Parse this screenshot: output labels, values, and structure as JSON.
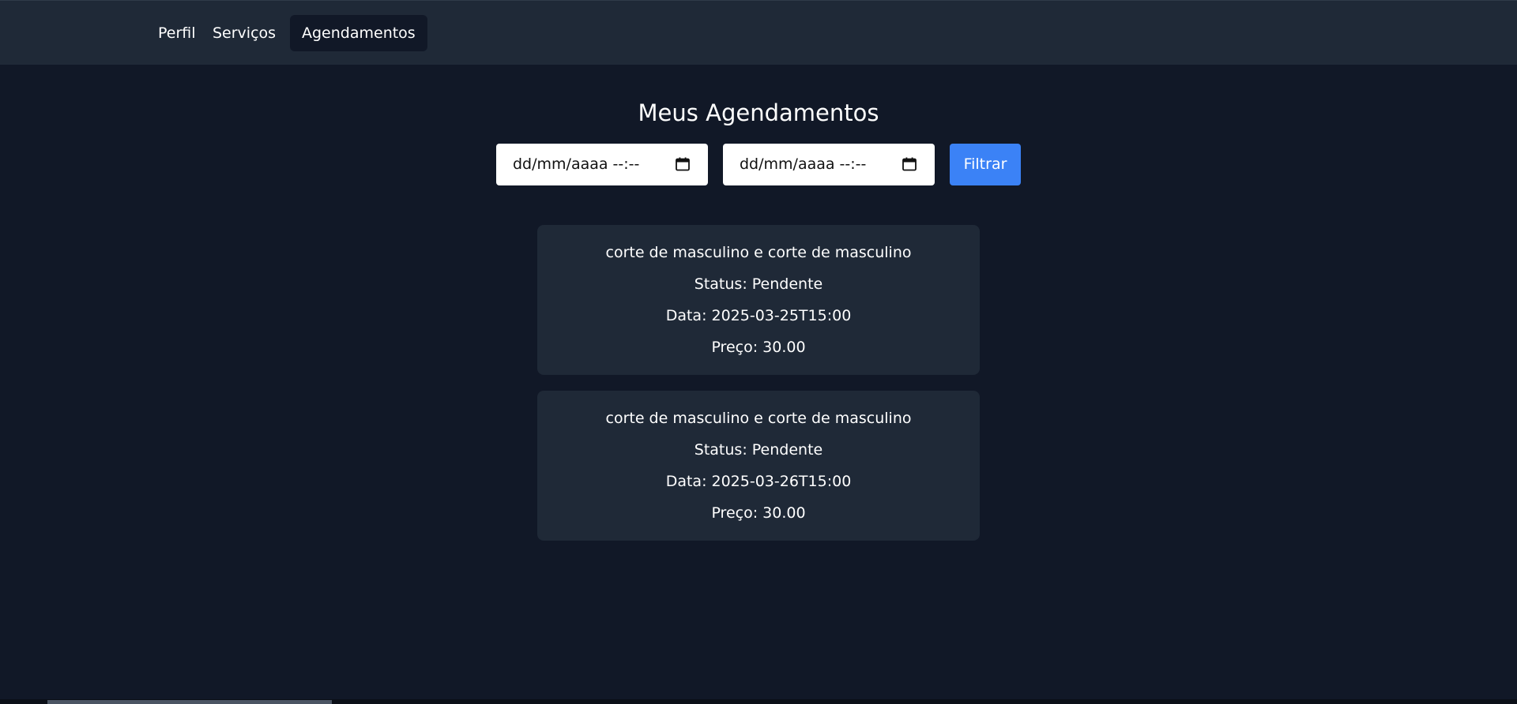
{
  "nav": {
    "items": [
      {
        "label": "Perfil"
      },
      {
        "label": "Serviços"
      },
      {
        "label": "Agendamentos"
      }
    ],
    "active": "Agendamentos"
  },
  "main": {
    "title": "Meus Agendamentos",
    "filters": {
      "from_value": "dd/mm/aaaa --:--",
      "to_value": "dd/mm/aaaa --:--",
      "button_label": "Filtrar"
    },
    "appointments": [
      {
        "service": "corte de masculino e corte de masculino",
        "status": "Status: Pendente",
        "date": "Data: 2025-03-25T15:00",
        "price": "Preço: 30.00"
      },
      {
        "service": "corte de masculino e corte de masculino",
        "status": "Status: Pendente",
        "date": "Data: 2025-03-26T15:00",
        "price": "Preço: 30.00"
      }
    ]
  },
  "colors": {
    "background": "#111827",
    "card": "#1f2937",
    "accent": "#3b82f6"
  },
  "icons": [
    "calendar-icon"
  ]
}
